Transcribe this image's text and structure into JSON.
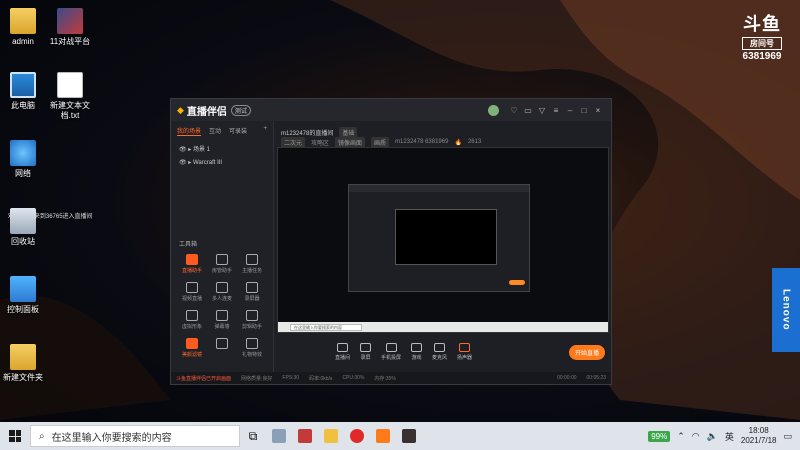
{
  "desktop": {
    "icons": [
      {
        "label": "admin",
        "icon": "user-folder-icon"
      },
      {
        "label": "11对战平台",
        "icon": "game-platform-icon"
      },
      {
        "label": "此电脑",
        "icon": "computer-icon"
      },
      {
        "label": "新建文本文档.txt",
        "icon": "text-file-icon"
      },
      {
        "label": "网络",
        "icon": "network-icon"
      },
      {
        "label": "回收站",
        "icon": "recycle-bin-icon"
      },
      {
        "label": "控制面板",
        "icon": "control-panel-icon"
      },
      {
        "label": "新建文件夹",
        "icon": "folder-icon"
      }
    ],
    "notice": "欢迎 ◎ ● 来到36765进入直播间",
    "watermark": {
      "logo": "斗鱼",
      "sub": "房间号",
      "room": "6381969"
    },
    "lenovo": "Lenovo"
  },
  "app": {
    "brand": "直播伴侣",
    "beta": "测试",
    "tabs": [
      "我的场景",
      "互动",
      "可录装"
    ],
    "scenes": [
      "场景 1",
      "Warcraft III"
    ],
    "toolbox_title": "工具箱",
    "tools": [
      "直播助手",
      "房管助手",
      "主播任务",
      "视频直播",
      "多人连麦",
      "录屏器",
      "虚拟形象",
      "弹幕墙",
      "剪辑助手",
      "美颜滤镜",
      "",
      "礼物特效"
    ],
    "room_title": "m1232478的直播间",
    "room_tag": "基础",
    "room_sub": [
      "二次元",
      "攻略区",
      "镜像画面",
      "画质"
    ],
    "room_id": "m1232478  6381969",
    "heat": "2613",
    "controls": [
      "直播间",
      "录屏",
      "手机投屏",
      "游戏",
      "麦克风",
      "扬声器"
    ],
    "start_live": "开始直播",
    "status_warn": "斗鱼直播伴侣已开启画面",
    "status_items": [
      "网络质量:良好",
      "FPS:30",
      "码率:0kb/s",
      "CPU:30%",
      "内存:35%"
    ],
    "times": [
      "00:00:00",
      "00:05:23"
    ],
    "preview_search": "在这里输入你要搜索的内容"
  },
  "taskbar": {
    "search_placeholder": "在这里输入你要搜索的内容",
    "battery": "99%",
    "ime": "英",
    "time": "18:08",
    "date": "2021/7/18"
  }
}
